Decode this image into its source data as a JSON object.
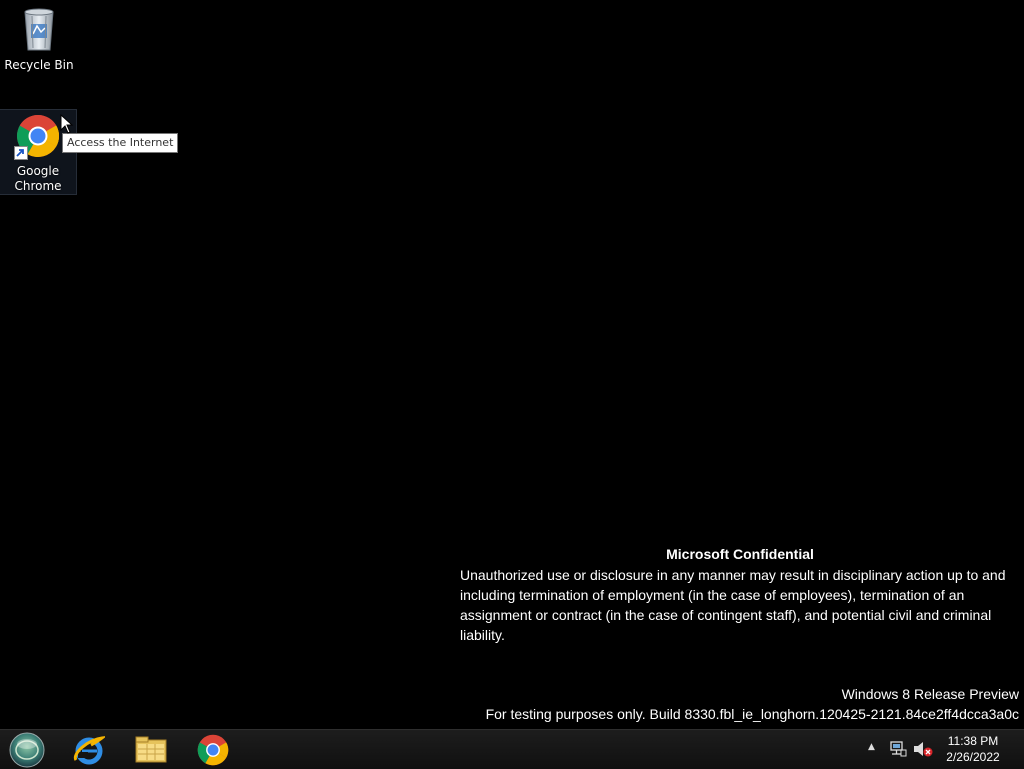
{
  "desktop": {
    "icons": [
      {
        "label": "Recycle Bin",
        "icon": "recycle-bin-icon"
      },
      {
        "label": "Google\nChrome",
        "label_line1": "Google",
        "label_line2": "Chrome",
        "icon": "chrome-icon",
        "selected": true
      }
    ],
    "tooltip": "Access the Internet"
  },
  "notice": {
    "title": "Microsoft Confidential",
    "body": "Unauthorized use or disclosure in any manner may result in disciplinary action up to and including termination of employment (in the case of employees), termination of an assignment or contract (in the case of contingent staff), and potential civil and criminal liability."
  },
  "watermark": {
    "edition": "Windows 8 Release Preview",
    "build": "For testing purposes only. Build 8330.fbl_ie_longhorn.120425-2121.84ce2ff4dcca3a0c"
  },
  "taskbar": {
    "pinned": [
      {
        "name": "start-button",
        "icon": "start-orb-icon"
      },
      {
        "name": "internet-explorer",
        "icon": "internet-explorer-icon"
      },
      {
        "name": "file-explorer",
        "icon": "folder-icon"
      },
      {
        "name": "google-chrome",
        "icon": "chrome-icon"
      }
    ],
    "tray": {
      "show_hidden_icon": "▲",
      "network_icon": "network-icon",
      "volume_icon": "volume-muted-icon"
    },
    "clock": {
      "time": "11:38 PM",
      "date": "2/26/2022"
    }
  },
  "colors": {
    "desktop_bg": "#000000",
    "taskbar_bg": "#151515",
    "chrome_red": "#DB4437",
    "chrome_yellow": "#F4B400",
    "chrome_green": "#0F9D58",
    "chrome_blue": "#4285F4"
  }
}
